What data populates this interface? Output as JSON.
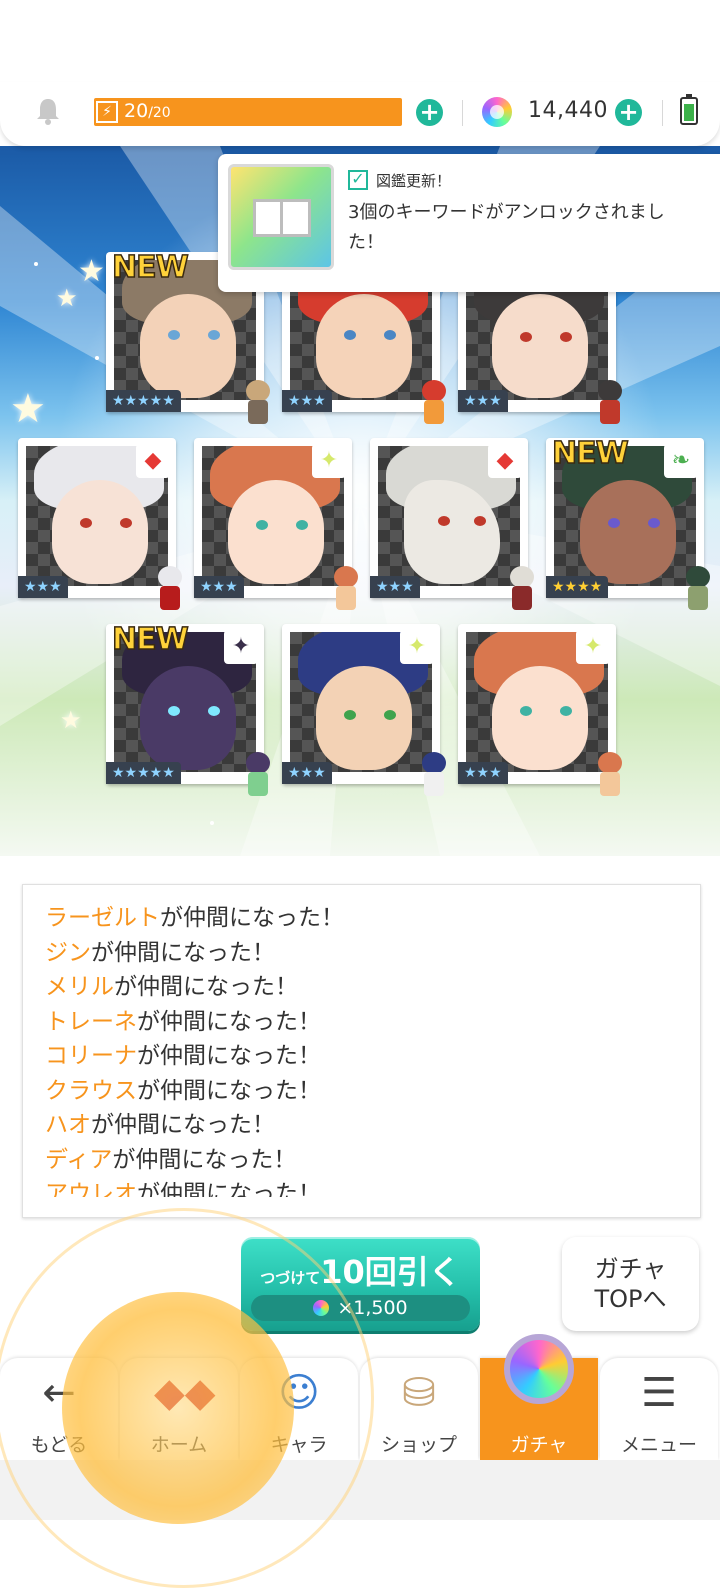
{
  "header": {
    "stamina_current": "20",
    "stamina_max": "/20",
    "stamina_fraction": 1.0,
    "gem_count": "14,440"
  },
  "notice": {
    "title": "図鑑更新！",
    "message": "3個のキーワードがアンロックされました！"
  },
  "cards": [
    {
      "name": "ラーゼルト",
      "rarity": "★★★★★",
      "new": "NEW",
      "attr_icon": ""
    },
    {
      "name": "ジン",
      "rarity": "★★★",
      "new": "",
      "attr_icon": ""
    },
    {
      "name": "メリル",
      "rarity": "★★★",
      "new": "",
      "attr_icon": ""
    },
    {
      "name": "トレーネ",
      "rarity": "★★★",
      "new": "",
      "attr_icon": "◆"
    },
    {
      "name": "コリーナ",
      "rarity": "★★★",
      "new": "",
      "attr_icon": "✦"
    },
    {
      "name": "クラウス",
      "rarity": "★★★",
      "new": "",
      "attr_icon": "◆"
    },
    {
      "name": "ハオ",
      "rarity": "★★★★",
      "new": "NEW",
      "attr_icon": "❧"
    },
    {
      "name": "ディア",
      "rarity": "★★★★★",
      "new": "NEW",
      "attr_icon": "✦"
    },
    {
      "name": "アウレオ",
      "rarity": "★★★",
      "new": "",
      "attr_icon": "✦"
    },
    {
      "name": "コリーナ",
      "rarity": "★★★",
      "new": "",
      "attr_icon": "✦"
    }
  ],
  "log": [
    {
      "name": "ラーゼルト",
      "text": "が仲間になった！"
    },
    {
      "name": "ジン",
      "text": "が仲間になった！"
    },
    {
      "name": "メリル",
      "text": "が仲間になった！"
    },
    {
      "name": "トレーネ",
      "text": "が仲間になった！"
    },
    {
      "name": "コリーナ",
      "text": "が仲間になった！"
    },
    {
      "name": "クラウス",
      "text": "が仲間になった！"
    },
    {
      "name": "ハオ",
      "text": "が仲間になった！"
    },
    {
      "name": "ディア",
      "text": "が仲間になった！"
    },
    {
      "name": "アウレオ",
      "text": "が仲間になった！"
    }
  ],
  "pull_button": {
    "prefix": "つづけて",
    "main": "10回引く",
    "cost": "×1,500"
  },
  "top_button": {
    "line1": "ガチャ",
    "line2": "TOPへ"
  },
  "nav": [
    {
      "label": "もどる",
      "icon": "back-arrow-icon"
    },
    {
      "label": "ホーム",
      "icon": "home-icon"
    },
    {
      "label": "キャラ",
      "icon": "character-icon"
    },
    {
      "label": "ショップ",
      "icon": "shop-icon"
    },
    {
      "label": "ガチャ",
      "icon": "gacha-icon",
      "active": true
    },
    {
      "label": "メニュー",
      "icon": "menu-icon"
    }
  ],
  "colors": {
    "accent_orange": "#f7941d",
    "accent_teal": "#20b89a"
  }
}
